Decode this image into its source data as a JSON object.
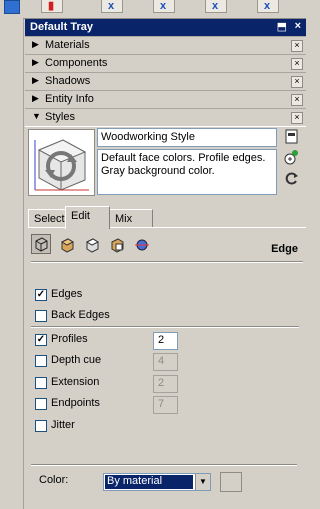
{
  "window": {
    "title": "Default Tray",
    "pin_glyph": "⬒",
    "close_glyph": "×"
  },
  "sections": [
    {
      "label": "Materials",
      "expanded": false
    },
    {
      "label": "Components",
      "expanded": false
    },
    {
      "label": "Shadows",
      "expanded": false
    },
    {
      "label": "Entity Info",
      "expanded": false
    },
    {
      "label": "Styles",
      "expanded": true
    }
  ],
  "glyphs": {
    "collapsed": "▶",
    "expanded": "▼",
    "close": "×",
    "check": "✓",
    "dropdown": "▼"
  },
  "styles": {
    "name": "Woodworking Style",
    "description": "Default face colors. Profile edges. Gray background color."
  },
  "tabs": [
    {
      "label": "Select",
      "active": false
    },
    {
      "label": "Edit",
      "active": true
    },
    {
      "label": "Mix",
      "active": false
    }
  ],
  "edit": {
    "panel_label": "Edge",
    "options": [
      {
        "label": "Edges",
        "checked": true
      },
      {
        "label": "Back Edges",
        "checked": false
      },
      {
        "label": "Profiles",
        "checked": true,
        "value": "2",
        "enabled": true
      },
      {
        "label": "Depth cue",
        "checked": false,
        "value": "4",
        "enabled": false
      },
      {
        "label": "Extension",
        "checked": false,
        "value": "2",
        "enabled": false
      },
      {
        "label": "Endpoints",
        "checked": false,
        "value": "7",
        "enabled": false
      },
      {
        "label": "Jitter",
        "checked": false
      }
    ],
    "color_label": "Color:",
    "color_value": "By material"
  },
  "colors": {
    "title_bar": "#0a246a",
    "panel_bg": "#d4d0c8",
    "selection": "#0a246a"
  }
}
